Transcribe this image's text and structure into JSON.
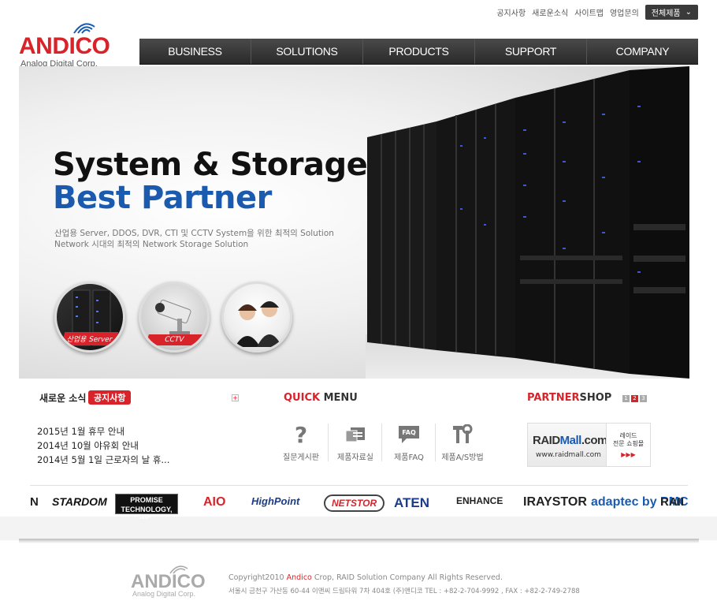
{
  "util": {
    "links": [
      "공지사항",
      "새로운소식",
      "사이트맵",
      "영업문의"
    ],
    "all_products": "전체제품"
  },
  "logo": {
    "brand": "ANDICO",
    "tagline": "Analog Digital Corp."
  },
  "nav": [
    "BUSINESS",
    "SOLUTIONS",
    "PRODUCTS",
    "SUPPORT",
    "COMPANY"
  ],
  "hero": {
    "title1": "System & Storage",
    "title2": "Best Partner",
    "desc1": "산업용 Server, DDOS, DVR, CTI 및 CCTV System을 위한 최적의 Solution",
    "desc2": "Network 시대의 최적의 Network Storage Solution",
    "circles": [
      "산업용 Server",
      "CCTV",
      ""
    ]
  },
  "news": {
    "title": "새로운 소식",
    "tag": "공지사항",
    "items": [
      "2015년 1월 휴무 안내",
      "2014년 10월 야유회 안내",
      "2014년 5월 1일 근로자의 날 휴..."
    ]
  },
  "quick": {
    "title_red": "QUICK",
    "title_rest": " MENU",
    "items": [
      "질문게시판",
      "제품자료실",
      "제품FAQ",
      "제품A/S방법"
    ]
  },
  "partner": {
    "title_red": "PARTNER",
    "title_rest": "SHOP",
    "pages": [
      "1",
      "2",
      "3"
    ],
    "banner_name_1": "RAID",
    "banner_name_2": "Mall",
    "banner_name_3": ".com",
    "banner_url": "www.raidmall.com",
    "banner_side": "레이드\n전문 쇼핑몰",
    "banner_arrows": "▶▶▶"
  },
  "logos": [
    "N",
    "STARDOM",
    "PROMISE TECHNOLOGY, INC.",
    "AIO",
    "HighPoint",
    "NETSTOR",
    "ATEN",
    "ENHANCE",
    "IRAYSTOR",
    "adaptec by PMC",
    "RAII"
  ],
  "footer": {
    "brand": "ANDICO",
    "tagline": "Analog Digital Corp.",
    "copy_pre": "Copyright2010 ",
    "copy_red": "Andico",
    "copy_post": " Crop, RAID Solution Company All Rights Reserved.",
    "address": "서울시 금천구 가산동 60-44 이앤씨 드림타워 7차 404호 (주)앤디코   TEL : +82-2-704-9992 , FAX : +82-2-749-2788"
  },
  "colors": {
    "brand_red": "#d8232a",
    "brand_blue": "#1a5bb0",
    "nav_bg": "#333333"
  }
}
